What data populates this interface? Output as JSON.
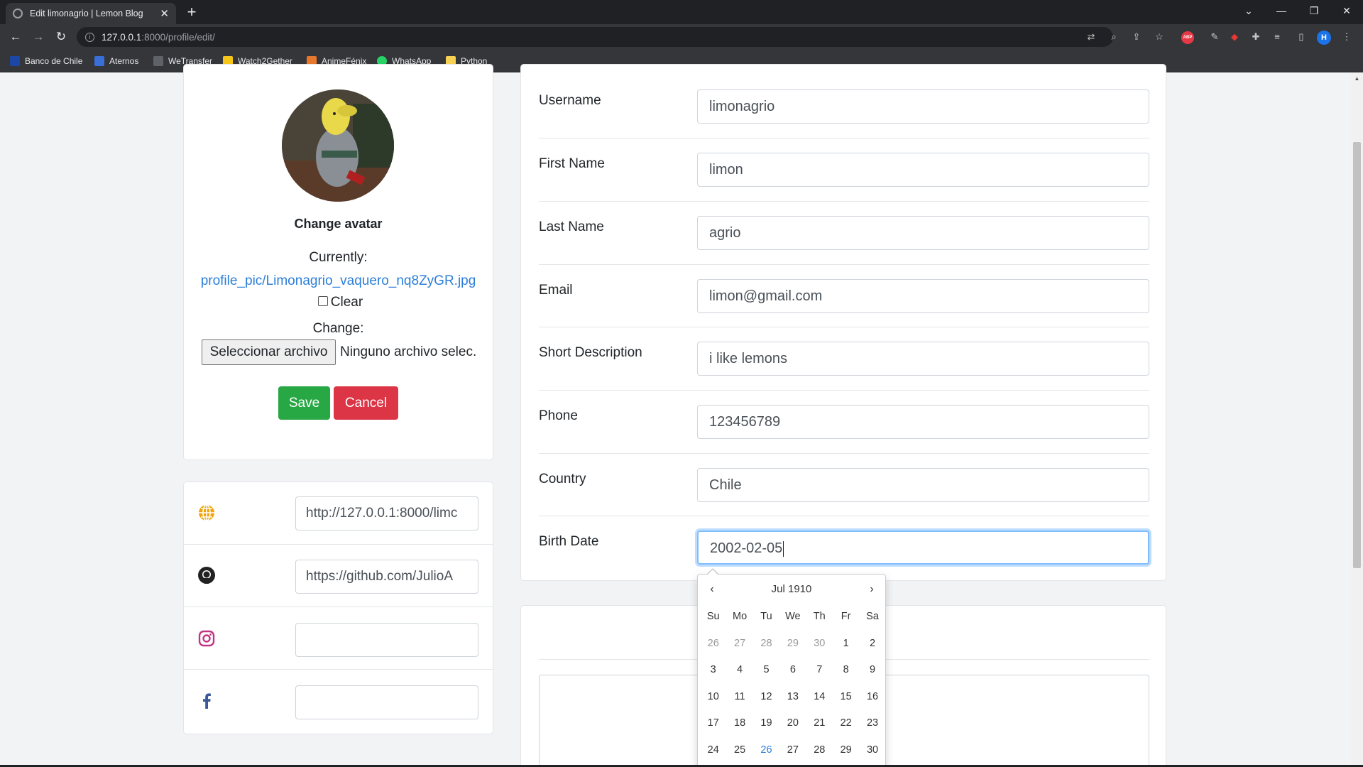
{
  "browser": {
    "tab_title": "Edit limonagrio | Lemon Blog",
    "tab_close": "✕",
    "new_tab": "+",
    "url_host": "127.0.0.1",
    "url_path": ":8000/profile/edit/",
    "profile_initial": "H",
    "abp_label": "ABP",
    "bookmarks": [
      {
        "label": "Banco de Chile",
        "color": "#1c47a6"
      },
      {
        "label": "Aternos",
        "color": "#3a6fd8"
      },
      {
        "label": "WeTransfer",
        "color": "#202124"
      },
      {
        "label": "Watch2Gether",
        "color": "#f5c518"
      },
      {
        "label": "AnimeFénix",
        "color": "#e8772e"
      },
      {
        "label": "WhatsApp",
        "color": "#25d366"
      },
      {
        "label": "Python",
        "color": "#f7d154"
      }
    ]
  },
  "avatar_card": {
    "heading": "Change avatar",
    "currently_label": "Currently:",
    "current_file": "profile_pic/Limonagrio_vaquero_nq8ZyGR.jpg",
    "clear_label": "Clear",
    "change_label": "Change:",
    "file_button": "Seleccionar archivo",
    "file_none": "Ninguno archivo selec.",
    "save": "Save",
    "cancel": "Cancel"
  },
  "social": [
    {
      "icon": "globe-icon",
      "value": "http://127.0.0.1:8000/limc",
      "color": "#f0a30a"
    },
    {
      "icon": "github-icon",
      "value": "https://github.com/JulioA",
      "color": "#222222"
    },
    {
      "icon": "instagram-icon",
      "value": "",
      "color": "#c13584"
    },
    {
      "icon": "facebook-icon",
      "value": "",
      "color": "#3b5998"
    }
  ],
  "form": {
    "username": {
      "label": "Username",
      "value": "limonagrio"
    },
    "first_name": {
      "label": "First Name",
      "value": "limon"
    },
    "last_name": {
      "label": "Last Name",
      "value": "agrio"
    },
    "email": {
      "label": "Email",
      "value": "limon@gmail.com"
    },
    "short_description": {
      "label": "Short Description",
      "value": "i like lemons"
    },
    "phone": {
      "label": "Phone",
      "value": "123456789"
    },
    "country": {
      "label": "Country",
      "value": "Chile"
    },
    "birth_date": {
      "label": "Birth Date",
      "value": "2002-02-05"
    }
  },
  "datepicker": {
    "prev": "‹",
    "next": "›",
    "title": "Jul 1910",
    "dow": [
      "Su",
      "Mo",
      "Tu",
      "We",
      "Th",
      "Fr",
      "Sa"
    ],
    "weeks": [
      [
        "26",
        "27",
        "28",
        "29",
        "30",
        "1",
        "2"
      ],
      [
        "3",
        "4",
        "5",
        "6",
        "7",
        "8",
        "9"
      ],
      [
        "10",
        "11",
        "12",
        "13",
        "14",
        "15",
        "16"
      ],
      [
        "17",
        "18",
        "19",
        "20",
        "21",
        "22",
        "23"
      ],
      [
        "24",
        "25",
        "26",
        "27",
        "28",
        "29",
        "30"
      ]
    ]
  }
}
